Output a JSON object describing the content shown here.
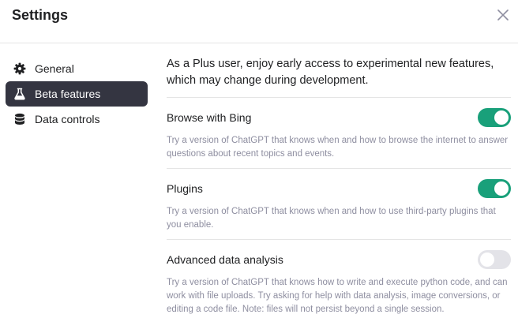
{
  "dialog": {
    "title": "Settings",
    "close_icon": "close-icon"
  },
  "sidebar": {
    "items": [
      {
        "label": "General",
        "icon": "gear-icon",
        "active": false
      },
      {
        "label": "Beta features",
        "icon": "flask-icon",
        "active": true
      },
      {
        "label": "Data controls",
        "icon": "database-icon",
        "active": false
      }
    ]
  },
  "main": {
    "intro": "As a Plus user, enjoy early access to experimental new features, which may change during development.",
    "features": [
      {
        "name": "Browse with Bing",
        "enabled": true,
        "description": "Try a version of ChatGPT that knows when and how to browse the internet to answer questions about recent topics and events."
      },
      {
        "name": "Plugins",
        "enabled": true,
        "description": "Try a version of ChatGPT that knows when and how to use third-party plugins that you enable."
      },
      {
        "name": "Advanced data analysis",
        "enabled": false,
        "description": "Try a version of ChatGPT that knows how to write and execute python code, and can work with file uploads. Try asking for help with data analysis, image conversions, or editing a code file. Note: files will not persist beyond a single session."
      }
    ]
  },
  "colors": {
    "toggle_on": "#19a07a",
    "toggle_off": "#e3e3e8",
    "active_nav_bg": "#343541"
  }
}
